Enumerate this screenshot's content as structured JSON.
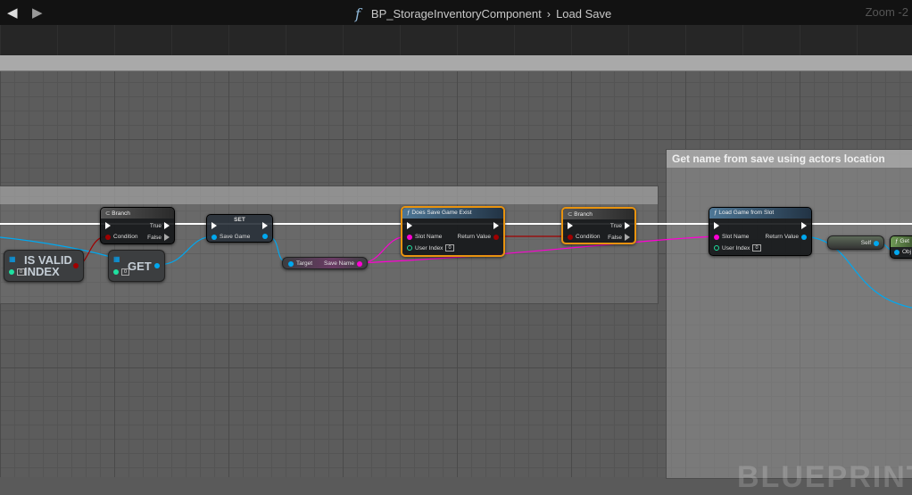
{
  "topbar": {
    "back": "◀",
    "forward": "▶",
    "function_icon": "f",
    "blueprint": "BP_StorageInventoryComponent",
    "separator": "›",
    "function": "Load Save",
    "zoom": "Zoom -2"
  },
  "comments": {
    "right_title": "Get name from save using actors location"
  },
  "watermark": "BLUEPRINT",
  "nodes": {
    "branch1": {
      "title": "Branch",
      "true": "True",
      "false": "False",
      "condition": "Condition"
    },
    "set": {
      "title": "SET",
      "pin": "Save Game"
    },
    "is_valid": {
      "title": "IS VALID INDEX",
      "index": "0"
    },
    "get": {
      "title": "GET",
      "index": "0"
    },
    "save_name": {
      "target": "Target",
      "out": "Save Name"
    },
    "does_exist": {
      "title": "Does Save Game Exist",
      "slot": "Slot Name",
      "user": "User Index",
      "user_value": "0",
      "ret": "Return Value"
    },
    "branch2": {
      "title": "Branch",
      "true": "True",
      "false": "False",
      "condition": "Condition"
    },
    "load": {
      "title": "Load Game from Slot",
      "slot": "Slot Name",
      "user": "User Index",
      "user_value": "0",
      "ret": "Return Value"
    },
    "self": {
      "label": "Self"
    },
    "get_partial": {
      "title": "Get",
      "pin": "Obj"
    }
  },
  "colors": {
    "exec": "#ffffff",
    "bool": "#8c0000",
    "object": "#00a8f0",
    "string": "#ff00d4",
    "int": "#1fe0a0",
    "selected": "#e8930f"
  }
}
